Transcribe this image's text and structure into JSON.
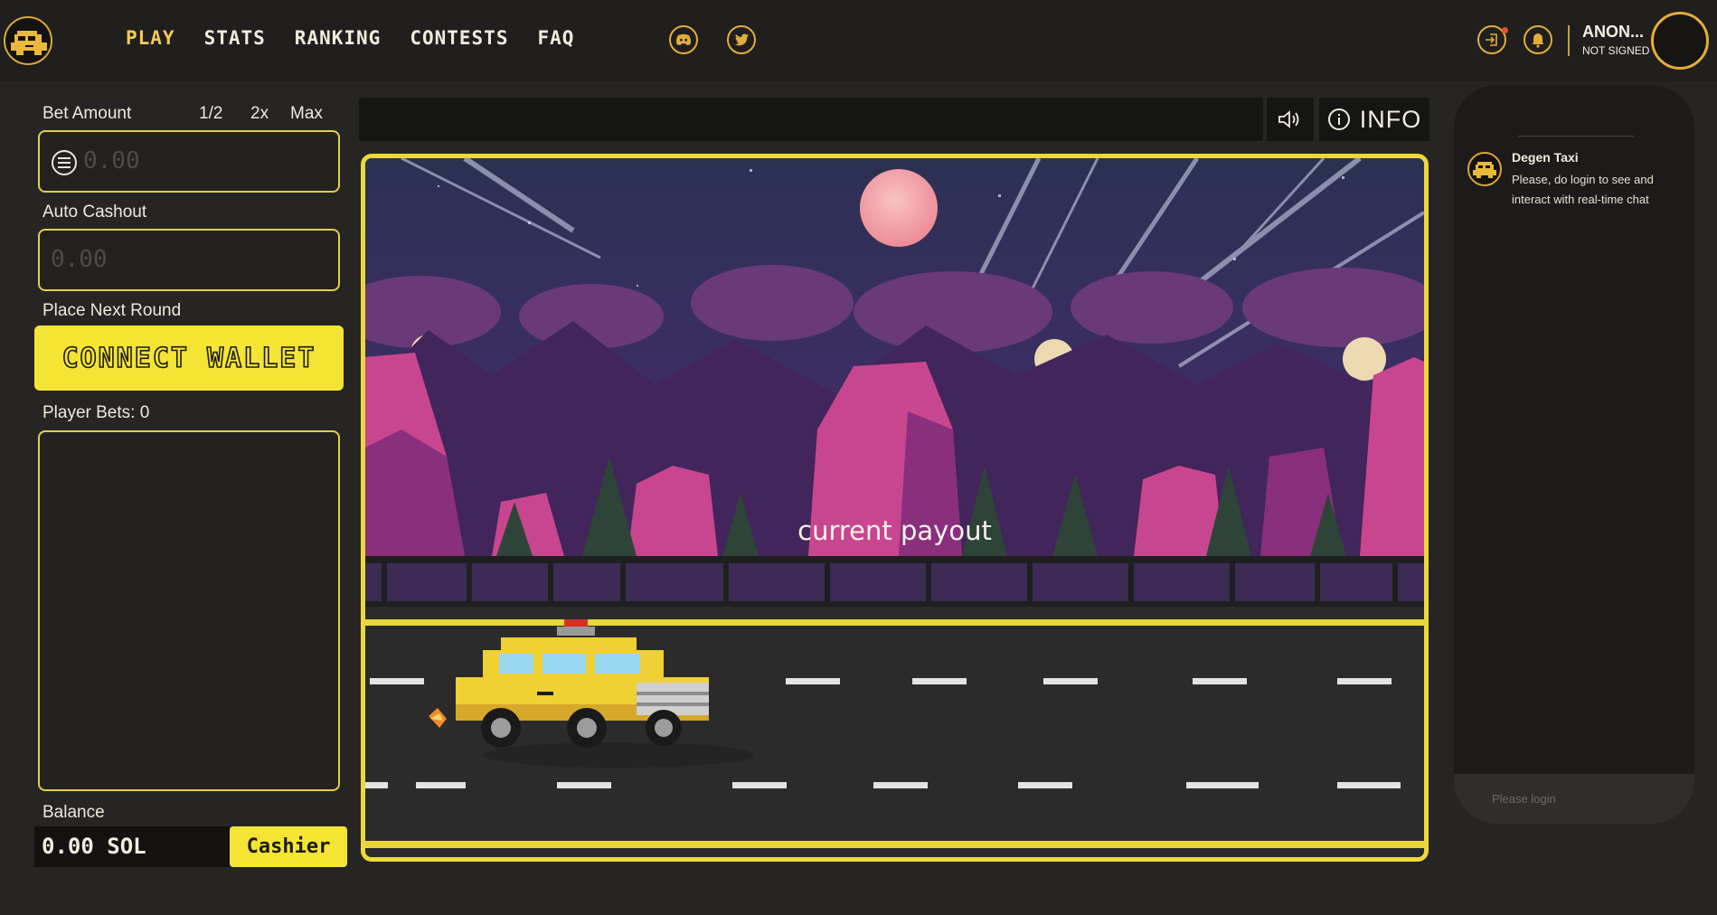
{
  "header": {
    "nav": [
      {
        "label": "PLAY",
        "active": true
      },
      {
        "label": "STATS",
        "active": false
      },
      {
        "label": "RANKING",
        "active": false
      },
      {
        "label": "CONTESTS",
        "active": false
      },
      {
        "label": "FAQ",
        "active": false
      }
    ],
    "social_icons": [
      "discord-icon",
      "twitter-icon"
    ],
    "action_icons": [
      "login-icon",
      "bell-icon"
    ],
    "user": {
      "name": "ANON...",
      "status": "NOT SIGNED"
    },
    "accent_color": "#f6c95a"
  },
  "left_panel": {
    "bet_amount_label": "Bet Amount",
    "multipliers": [
      "1/2",
      "2x",
      "Max"
    ],
    "bet_amount_value": "0.00",
    "auto_cashout_label": "Auto Cashout",
    "auto_cashout_value": "0.00",
    "place_next_round_label": "Place Next Round",
    "connect_wallet_label": "CONNECT WALLET",
    "player_bets_label": "Player Bets: 0",
    "balance_label": "Balance",
    "balance_value": "0.00 SOL",
    "cashier_label": "Cashier",
    "button_color": "#f4e535"
  },
  "game": {
    "info_label": "INFO",
    "payout_text": "current payout",
    "frame_color": "#ecd83a"
  },
  "chat": {
    "messages": [
      {
        "author": "Degen Taxi",
        "text": "Please, do login to see and interact with real-time chat"
      }
    ],
    "input_placeholder": "Please login"
  }
}
